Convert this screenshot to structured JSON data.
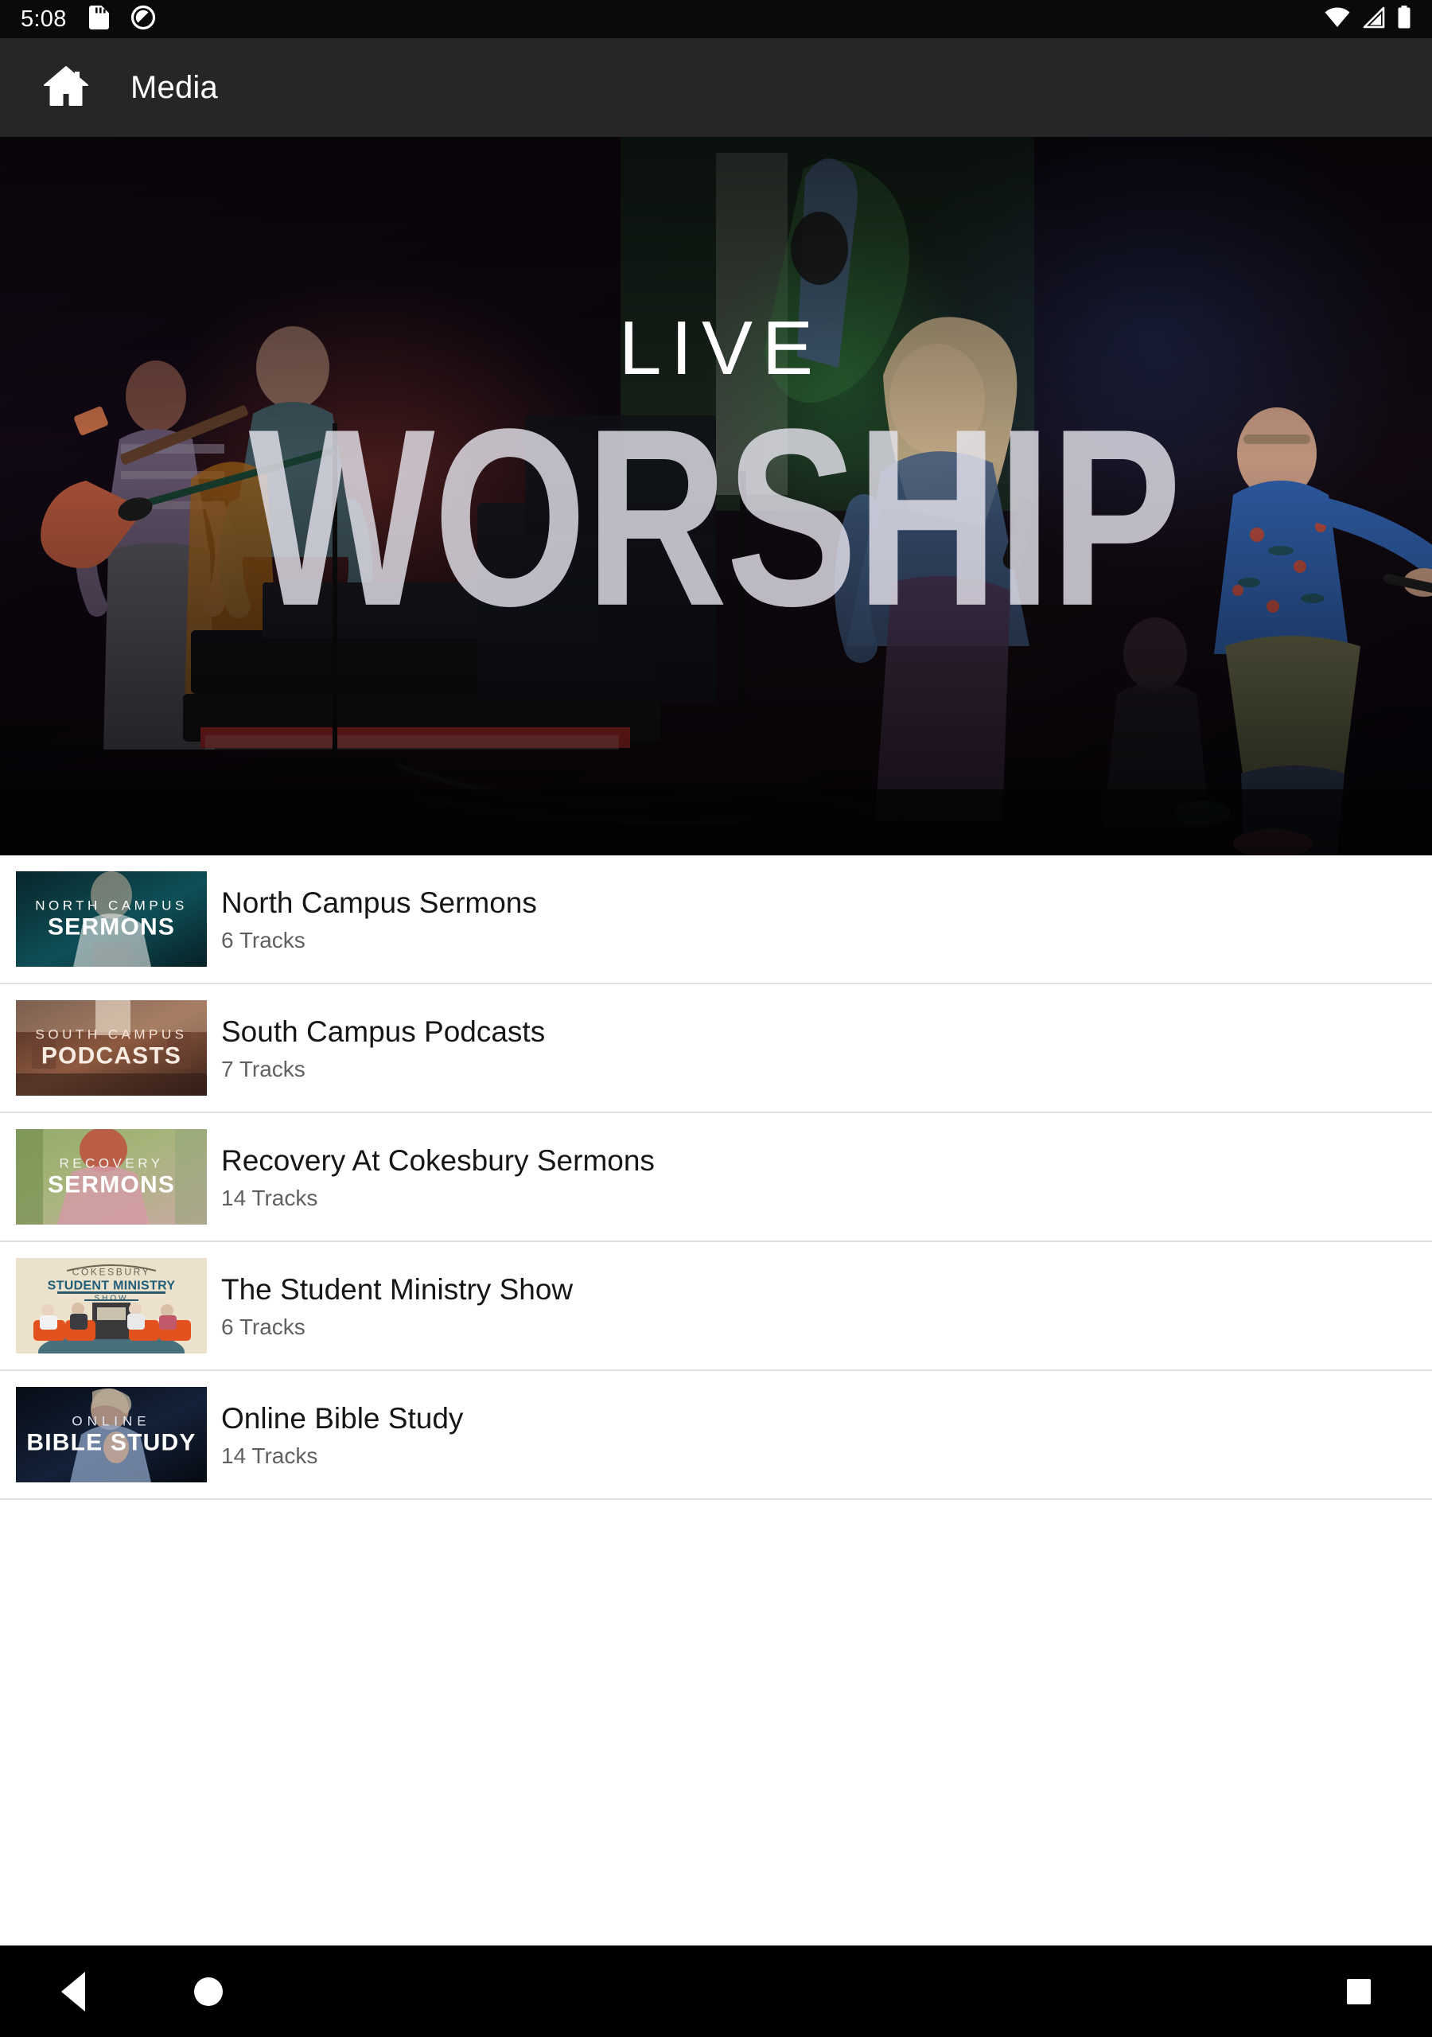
{
  "status_bar": {
    "time": "5:08",
    "left_icons": [
      "sd-card-icon",
      "do-not-disturb-icon"
    ],
    "right_icons": [
      "wifi-icon",
      "cellular-signal-icon",
      "battery-icon"
    ],
    "background_color": "#0a0a0a"
  },
  "app_bar": {
    "home_icon": "home-icon",
    "title": "Media",
    "background_color": "#262626",
    "text_color": "#ffffff"
  },
  "hero": {
    "line1": "LIVE",
    "line2": "WORSHIP",
    "alt": "Live worship band performing on a dark stage",
    "text_color": "#ffffff"
  },
  "list": {
    "items": [
      {
        "title": "North Campus Sermons",
        "subtitle": "6 Tracks",
        "thumb": {
          "top_text": "NORTH CAMPUS",
          "bottom_text": "SERMONS",
          "bg_start": "#0b2f33",
          "bg_end": "#12565c",
          "text_color": "#ffffff"
        }
      },
      {
        "title": "South Campus Podcasts",
        "subtitle": "7 Tracks",
        "thumb": {
          "top_text": "SOUTH CAMPUS",
          "bottom_text": "PODCASTS",
          "bg_start": "#5a372c",
          "bg_end": "#b07a5e",
          "text_color": "#f6e3d8"
        }
      },
      {
        "title": "Recovery At Cokesbury Sermons",
        "subtitle": "14 Tracks",
        "thumb": {
          "top_text": "RECOVERY",
          "bottom_text": "SERMONS",
          "bg_start": "#8fa86a",
          "bg_end": "#c6a6a2",
          "text_color": "#f2f2ee"
        }
      },
      {
        "title": "The Student Ministry Show",
        "subtitle": "6 Tracks",
        "thumb": {
          "top_text": "COKESBURY",
          "bottom_text": "STUDENT MINISTRY",
          "caption": "SHOW",
          "bg_start": "#efe4cf",
          "bg_end": "#e6d8bf",
          "text_color": "#1f5e7a"
        }
      },
      {
        "title": "Online Bible Study",
        "subtitle": "14 Tracks",
        "thumb": {
          "top_text": "ONLINE",
          "bottom_text": "BIBLE STUDY",
          "bg_start": "#0a1322",
          "bg_end": "#16233a",
          "text_color": "#ffffff"
        }
      }
    ]
  },
  "nav_bar": {
    "back_label": "Back",
    "home_label": "Home",
    "recents_label": "Recents",
    "background_color": "#000000"
  }
}
